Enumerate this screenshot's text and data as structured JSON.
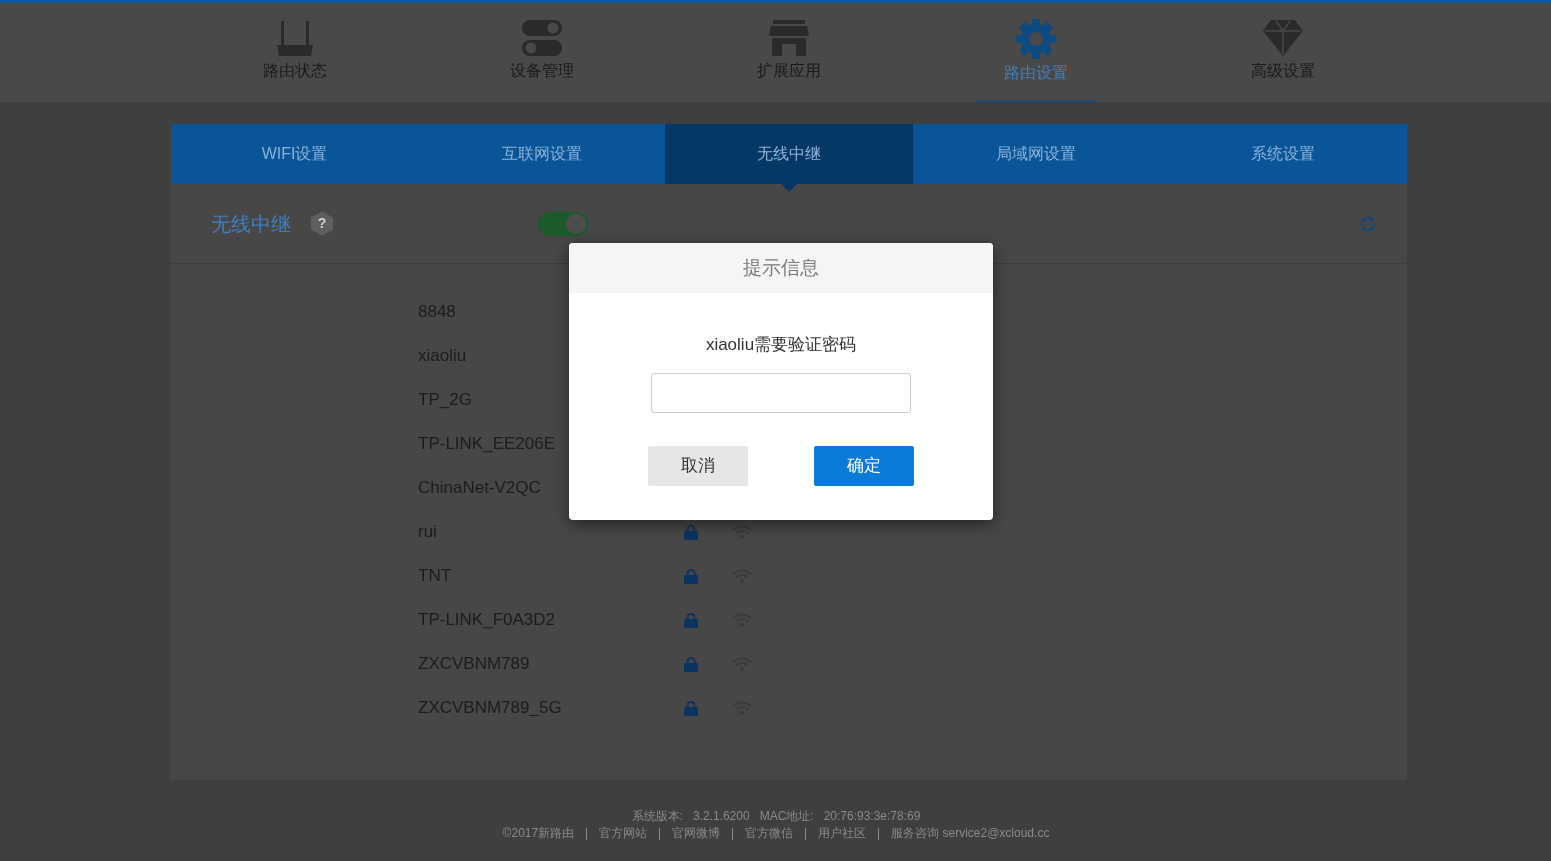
{
  "top_nav": [
    {
      "label": "路由状态",
      "selected": false
    },
    {
      "label": "设备管理",
      "selected": false
    },
    {
      "label": "扩展应用",
      "selected": false
    },
    {
      "label": "路由设置",
      "selected": true
    },
    {
      "label": "高级设置",
      "selected": false
    }
  ],
  "tabs": [
    {
      "label": "WIFI设置",
      "selected": false
    },
    {
      "label": "互联网设置",
      "selected": false
    },
    {
      "label": "无线中继",
      "selected": true
    },
    {
      "label": "局域网设置",
      "selected": false
    },
    {
      "label": "系统设置",
      "selected": false
    }
  ],
  "section": {
    "title": "无线中继",
    "help": "?",
    "toggle_on": true
  },
  "networks": [
    {
      "name": "8848"
    },
    {
      "name": "xiaoliu"
    },
    {
      "name": "TP_2G"
    },
    {
      "name": "TP-LINK_EE206E"
    },
    {
      "name": "ChinaNet-V2QC"
    },
    {
      "name": "rui"
    },
    {
      "name": "TNT"
    },
    {
      "name": "TP-LINK_F0A3D2"
    },
    {
      "name": "ZXCVBNM789"
    },
    {
      "name": "ZXCVBNM789_5G"
    }
  ],
  "footer": {
    "line1": [
      "系统版本:",
      "3.2.1.6200",
      "MAC地址:",
      "20:76:93:3e:78:69"
    ],
    "links": [
      "©2017新路由",
      "官方网站",
      "官网微博",
      "官方微信",
      "用户社区",
      "服务咨询 service2@xcloud.cc"
    ]
  },
  "dialog": {
    "title": "提示信息",
    "message": "xiaoliu需要验证密码",
    "cancel": "取消",
    "confirm": "确定"
  }
}
